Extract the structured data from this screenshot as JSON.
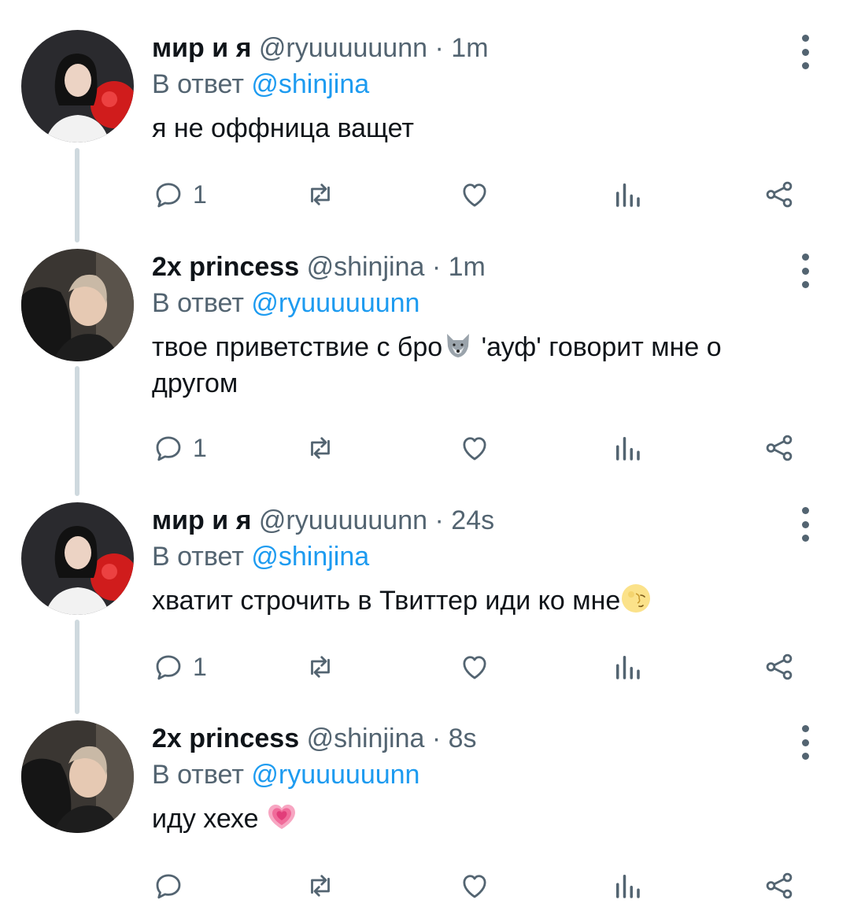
{
  "reply_prefix": "В ответ",
  "tweets": [
    {
      "name": "мир и я",
      "handle": "@ryuuuuuunn",
      "time": "1m",
      "reply_to": "@shinjina",
      "text": "я не оффница ващет",
      "emoji": "",
      "text_after": "",
      "reply_count": "1"
    },
    {
      "name": "2x princess",
      "handle": "@shinjina",
      "time": "1m",
      "reply_to": "@ryuuuuuunn",
      "text": "твое приветствие с бро",
      "emoji": "wolf",
      "text_after": " 'ауф' говорит мне о другом",
      "reply_count": "1"
    },
    {
      "name": "мир и я",
      "handle": "@ryuuuuuunn",
      "time": "24s",
      "reply_to": "@shinjina",
      "text": "хватит строчить в Твиттер иди ко мне",
      "emoji": "moon-face",
      "text_after": "",
      "reply_count": "1"
    },
    {
      "name": "2x princess",
      "handle": "@shinjina",
      "time": "8s",
      "reply_to": "@ryuuuuuunn",
      "text": "иду хехе ",
      "emoji": "growing-heart",
      "text_after": "",
      "reply_count": ""
    }
  ],
  "colors": {
    "accent": "#1d9bf0",
    "secondary_text": "#536471",
    "thread_line": "#cfd9de"
  }
}
